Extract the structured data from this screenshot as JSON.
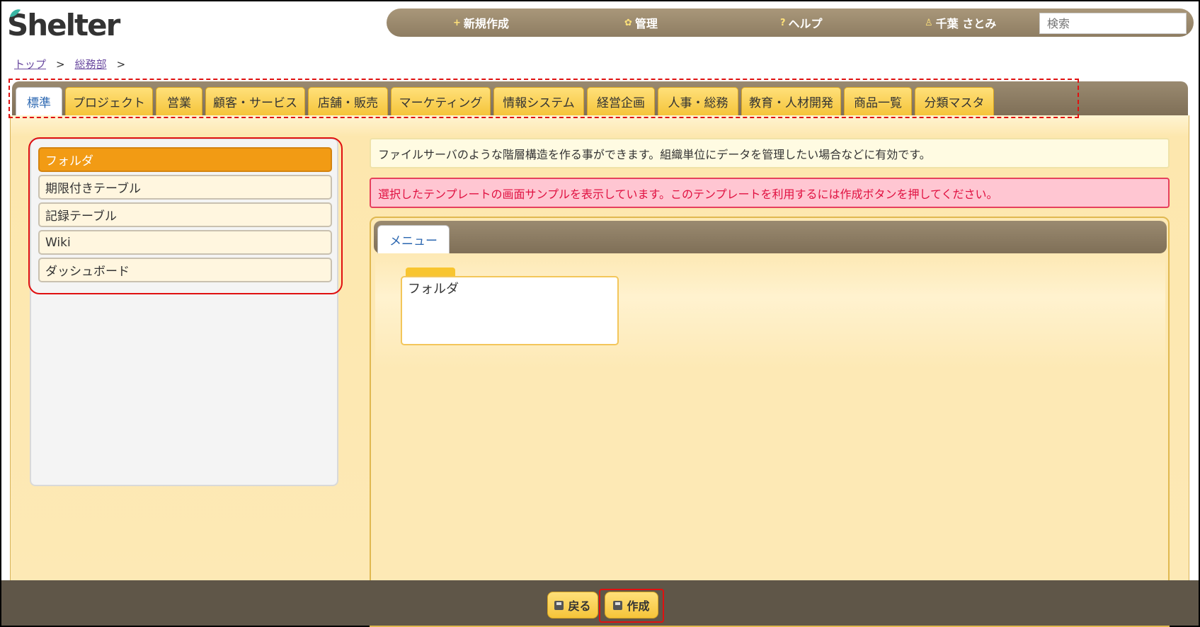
{
  "logo": {
    "text": "Shelter"
  },
  "topnav": {
    "new": "新規作成",
    "admin": "管理",
    "help": "ヘルプ",
    "user": "千葉 さとみ",
    "search_placeholder": "検索"
  },
  "breadcrumb": {
    "top": "トップ",
    "dept": "総務部",
    "sep": ">"
  },
  "tabs": [
    "標準",
    "プロジェクト",
    "営業",
    "顧客・サービス",
    "店舗・販売",
    "マーケティング",
    "情報システム",
    "経営企画",
    "人事・総務",
    "教育・人材開発",
    "商品一覧",
    "分類マスタ"
  ],
  "active_tab": "標準",
  "templates": [
    "フォルダ",
    "期限付きテーブル",
    "記録テーブル",
    "Wiki",
    "ダッシュボード"
  ],
  "active_template": "フォルダ",
  "info_message": "ファイルサーバのような階層構造を作る事ができます。組織単位にデータを管理したい場合などに有効です。",
  "alert_message": "選択したテンプレートの画面サンプルを表示しています。このテンプレートを利用するには作成ボタンを押してください。",
  "preview": {
    "tab": "メニュー",
    "folder": "フォルダ"
  },
  "footer": {
    "back": "戻る",
    "create": "作成"
  },
  "colors": {
    "accent": "#f29b14",
    "tab_yellow": "#f5c43a",
    "alert_text": "#e01040",
    "nav_brown": "#8e7d62"
  }
}
